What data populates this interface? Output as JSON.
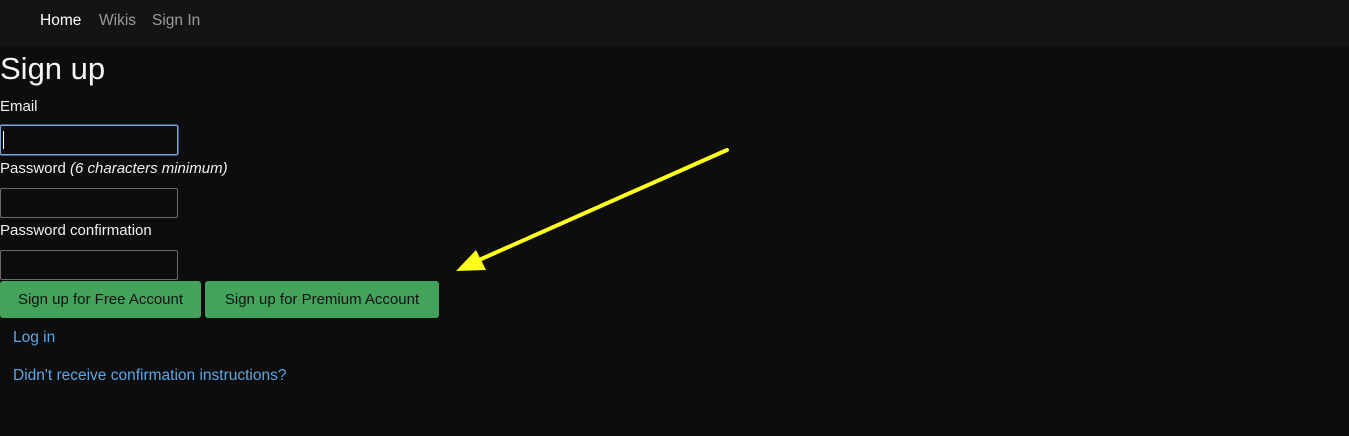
{
  "nav": {
    "home": "Home",
    "wikis": "Wikis",
    "sign_in": "Sign In"
  },
  "page": {
    "title": "Sign up"
  },
  "form": {
    "email_label": "Email",
    "email_value": "",
    "password_label": "Password",
    "password_hint": "(6 characters minimum)",
    "password_value": "",
    "confirmation_label": "Password confirmation",
    "confirmation_value": ""
  },
  "buttons": {
    "free": "Sign up for Free Account",
    "premium": "Sign up for Premium Account"
  },
  "links": {
    "log_in": "Log in",
    "confirmation_instructions": "Didn't receive confirmation instructions?"
  },
  "colors": {
    "background": "#0d0d0d",
    "navbar": "#141414",
    "button_green": "#44a35a",
    "link_blue": "#5aa7e6",
    "annotation_arrow": "#ffff1a"
  },
  "icons": {
    "annotation": "arrow-annotation-icon"
  }
}
